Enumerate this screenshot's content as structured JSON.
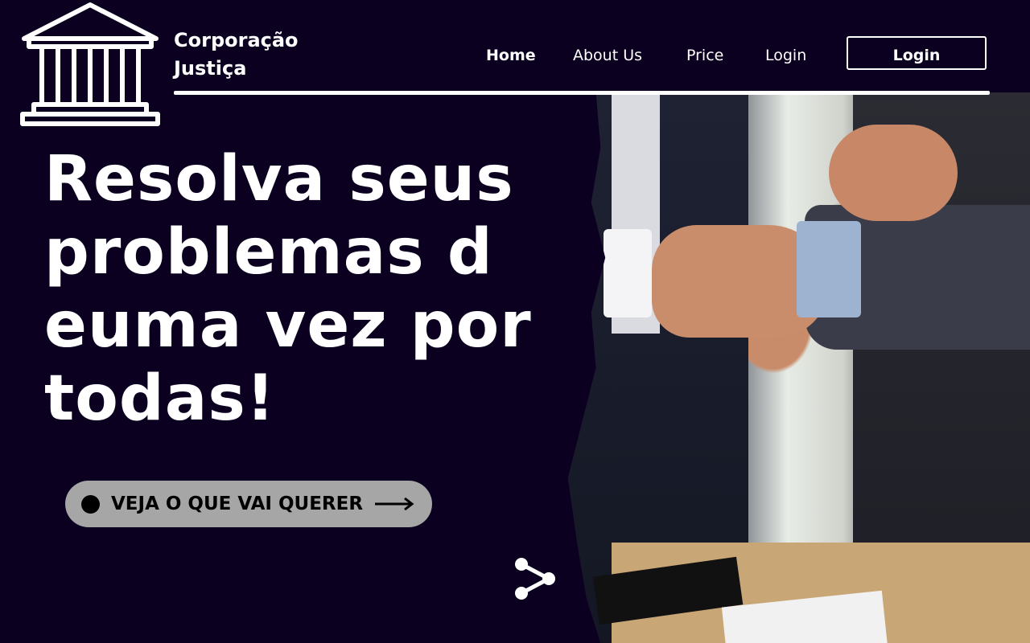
{
  "header": {
    "brand_line1": "Corporação",
    "brand_line2": "Justiça",
    "logo_icon": "courthouse-icon",
    "nav": [
      {
        "label": "Home",
        "active": true
      },
      {
        "label": "About Us",
        "active": false
      },
      {
        "label": "Price",
        "active": false
      },
      {
        "label": "Login",
        "active": false
      }
    ],
    "login_button": "Login"
  },
  "hero": {
    "title_line1": "Resolva seus",
    "title_line2": "problemas d",
    "title_line3": "euma vez por",
    "title_line4": "todas!",
    "cta_label": "VEJA O QUE VAI QUERER",
    "cta_icon": "arrow-right-icon",
    "share_icon": "share-icon",
    "image": "handshake-photo"
  },
  "colors": {
    "background": "#0b0020",
    "text": "#ffffff",
    "cta_background": "#a6a6a6",
    "cta_text": "#000000"
  }
}
